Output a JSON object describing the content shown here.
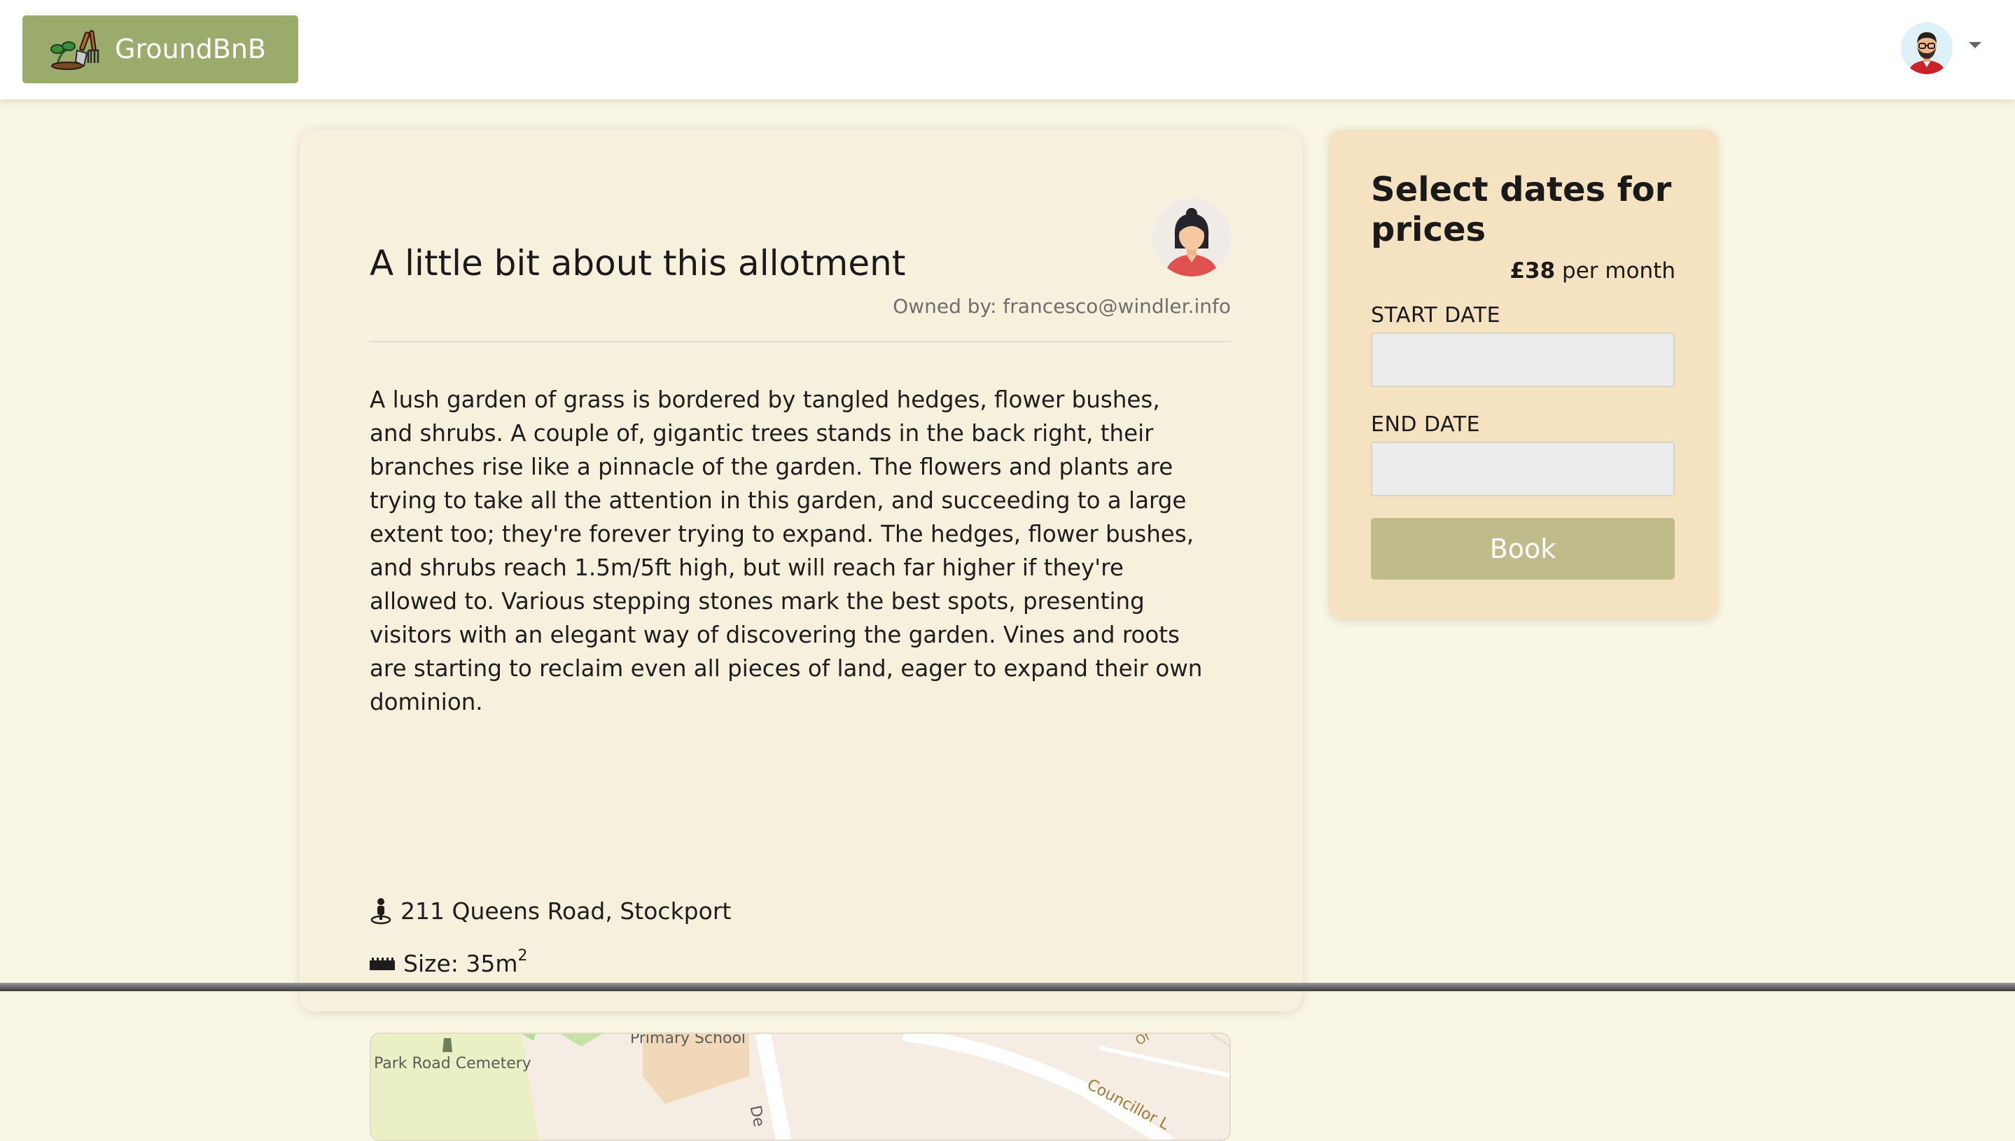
{
  "header": {
    "brand_name": "GroundBnB",
    "brand_icon": "garden-tools-icon",
    "user_avatar": "user-avatar-icon",
    "menu_caret": "chevron-down-icon"
  },
  "listing": {
    "title": "A little bit about this allotment",
    "owner_label": "Owned by: francesco@windler.info",
    "description": "A lush garden of grass is bordered by tangled hedges, flower bushes, and shrubs. A couple of, gigantic trees stands in the back right, their branches rise like a pinnacle of the garden. The flowers and plants are trying to take all the attention in this garden, and succeeding to a large extent too; they're forever trying to expand. The hedges, flower bushes, and shrubs reach 1.5m/5ft high, but will reach far higher if they're allowed to. Various stepping stones mark the best spots, presenting visitors with an elegant way of discovering the garden. Vines and roots are starting to reclaim even all pieces of land, eager to expand their own dominion.",
    "address": "211 Queens Road, Stockport",
    "size_label": "Size: 35m",
    "size_sup": "2",
    "map": {
      "label_cemetery": "Park Road Cemetery",
      "label_school": "Primary School",
      "label_road": "Councillor L",
      "label_road2": "De",
      "label_road3": "Or"
    }
  },
  "booking": {
    "title": "Select dates for prices",
    "price": "£38",
    "price_suffix": " per month",
    "start_label": "START DATE",
    "start_value": "",
    "end_label": "END DATE",
    "end_value": "",
    "book_label": "Book"
  },
  "colors": {
    "page_bg": "#faf6e4",
    "brand_green": "#9aab6c",
    "card_bg": "#f6f0dc",
    "booking_bg": "#f5e2c1",
    "button_bg": "#bfbb8b"
  }
}
